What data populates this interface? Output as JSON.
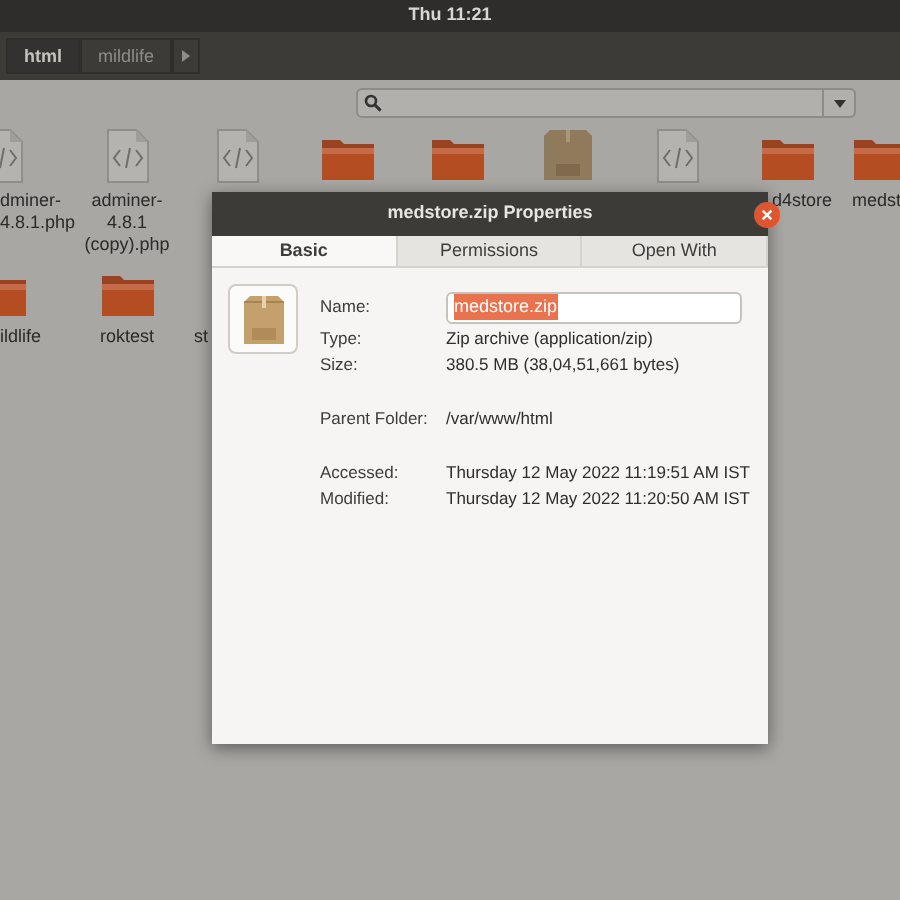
{
  "top_bar": {
    "clock": "Thu 11:21"
  },
  "path_bar": {
    "segments": [
      {
        "label": "html",
        "selected": true
      },
      {
        "label": "mildlife",
        "selected": false
      }
    ]
  },
  "files": [
    {
      "kind": "code",
      "label": "dminer-\n4.8.1.php"
    },
    {
      "kind": "code",
      "label": "adminer-\n4.8.1\n(copy).php"
    },
    {
      "kind": "code"
    },
    {
      "kind": "folder"
    },
    {
      "kind": "folder"
    },
    {
      "kind": "zip"
    },
    {
      "kind": "code"
    },
    {
      "kind": "folder",
      "label": "d4store"
    },
    {
      "kind": "folder",
      "label": "medst"
    }
  ],
  "files_row_2": [
    {
      "kind": "folder",
      "label": "ildlife"
    },
    {
      "kind": "folder",
      "label": "roktest"
    },
    {
      "label": "st"
    }
  ],
  "dialog": {
    "title": "medstore.zip Properties",
    "tabs": [
      {
        "label": "Basic",
        "selected": true
      },
      {
        "label": "Permissions",
        "selected": false
      },
      {
        "label": "Open With",
        "selected": false
      }
    ],
    "name": {
      "label": "Name:",
      "value": "medstore.zip",
      "selected": true
    },
    "groups": [
      [
        {
          "label": "Type:",
          "value": "Zip archive (application/zip)"
        },
        {
          "label": "Size:",
          "value": "380.5 MB (38,04,51,661 bytes)"
        }
      ],
      [
        {
          "label": "Parent Folder:",
          "value": "/var/www/html"
        }
      ],
      [
        {
          "label": "Accessed:",
          "value": "Thursday 12 May 2022 11:19:51 AM IST"
        },
        {
          "label": "Modified:",
          "value": "Thursday 12 May 2022 11:20:50 AM IST"
        }
      ]
    ]
  }
}
